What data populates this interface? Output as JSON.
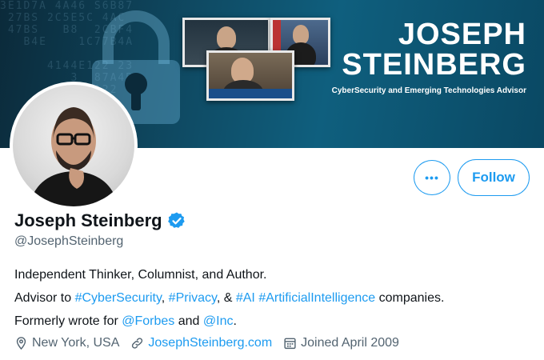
{
  "banner": {
    "name_line1": "JOSEPH",
    "name_line2": "STEINBERG",
    "tagline": "CyberSecurity and Emerging Technologies Advisor",
    "background_digits": "3E1D7A 4A46 S6B87\n 27BS 2C5E5C 4AC\n 47BS   B8  2CBF4\n   B4E    1C77B4A\n                 \n      4144E122 23\n         3  87A4B\n       4144E122"
  },
  "profile": {
    "display_name": "Joseph Steinberg",
    "verified": true,
    "handle": "@JosephSteinberg",
    "bio": {
      "line1": "Independent Thinker, Columnist, and Author.",
      "line2_prefix": "Advisor to ",
      "tag_cybersecurity": "#CyberSecurity",
      "sep1": ", ",
      "tag_privacy": "#Privacy",
      "sep2": ", & ",
      "tag_ai": "#AI",
      "sep3": " ",
      "tag_artificialintelligence": "#ArtificialIntelligence",
      "line2_suffix": " companies.",
      "line3_prefix": "Formerly wrote for ",
      "mention_forbes": "@Forbes",
      "line3_mid": " and ",
      "mention_inc": "@Inc",
      "line3_suffix": "."
    },
    "location": "New York, USA",
    "website": "JosephSteinberg.com",
    "joined": "Joined April 2009"
  },
  "actions": {
    "more_label": "•••",
    "follow_label": "Follow"
  },
  "colors": {
    "accent": "#1d9bf0",
    "secondary_text": "#536471",
    "primary_text": "#0f1419"
  },
  "icons": {
    "more": "more-icon",
    "verified": "verified-badge-icon",
    "location": "location-pin-icon",
    "link": "link-icon",
    "calendar": "calendar-icon"
  }
}
